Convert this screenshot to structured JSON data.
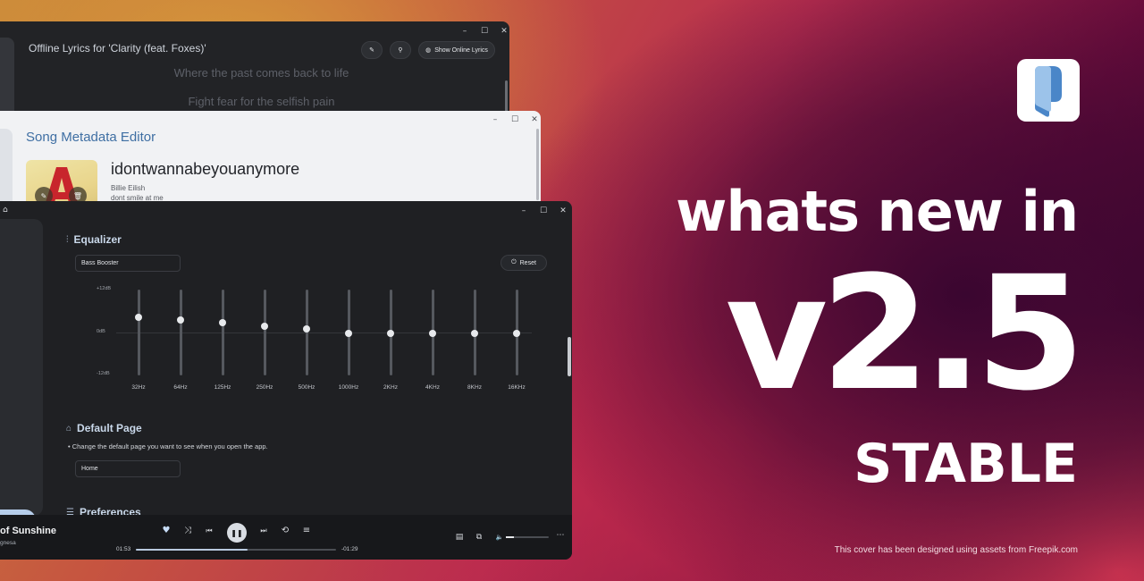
{
  "lyrics_window": {
    "title": "Offline Lyrics for 'Clarity (feat. Foxes)'",
    "edit_icon": "pencil-icon",
    "pin_icon": "pin-icon",
    "show_online_label": "Show Online Lyrics",
    "lines": [
      "Where the past comes back to life",
      "Fight fear for the selfish pain"
    ]
  },
  "metadata_window": {
    "title": "Song Metadata Editor",
    "song_title": "idontwannabeyouanymore",
    "artist": "Billie Eilish",
    "album": "dont smile at me"
  },
  "window_controls": {
    "minimize": "–",
    "maximize": "☐",
    "close": "✕"
  },
  "app_window": {
    "equalizer": {
      "title": "Equalizer",
      "preset": "Bass Booster",
      "reset_label": "Reset",
      "db_labels": {
        "max": "+12dB",
        "zero": "0dB",
        "min": "-12dB"
      },
      "bands": [
        {
          "freq": "32Hz",
          "gain_db": 4.3
        },
        {
          "freq": "64Hz",
          "gain_db": 3.5
        },
        {
          "freq": "125Hz",
          "gain_db": 2.7
        },
        {
          "freq": "250Hz",
          "gain_db": 1.8
        },
        {
          "freq": "500Hz",
          "gain_db": 1.0
        },
        {
          "freq": "1000Hz",
          "gain_db": -0.2
        },
        {
          "freq": "2KHz",
          "gain_db": -0.2
        },
        {
          "freq": "4KHz",
          "gain_db": -0.2
        },
        {
          "freq": "8KHz",
          "gain_db": -0.2
        },
        {
          "freq": "16KHz",
          "gain_db": -0.2
        }
      ]
    },
    "default_page": {
      "title": "Default Page",
      "description": "Change the default page you want to see when you open the app.",
      "value": "Home"
    },
    "preferences": {
      "title": "Preferences"
    },
    "player": {
      "song_title": "of Sunshine",
      "artist": "gnesa",
      "elapsed": "01:53",
      "remaining": "-01:29",
      "progress": 0.56,
      "volume": 0.18
    }
  },
  "promo": {
    "headline": "whats new in",
    "version": "v2.5",
    "label": "STABLE",
    "credit": "This cover has been designed using assets from Freepik.com",
    "accent_color": "#b82d4f"
  }
}
